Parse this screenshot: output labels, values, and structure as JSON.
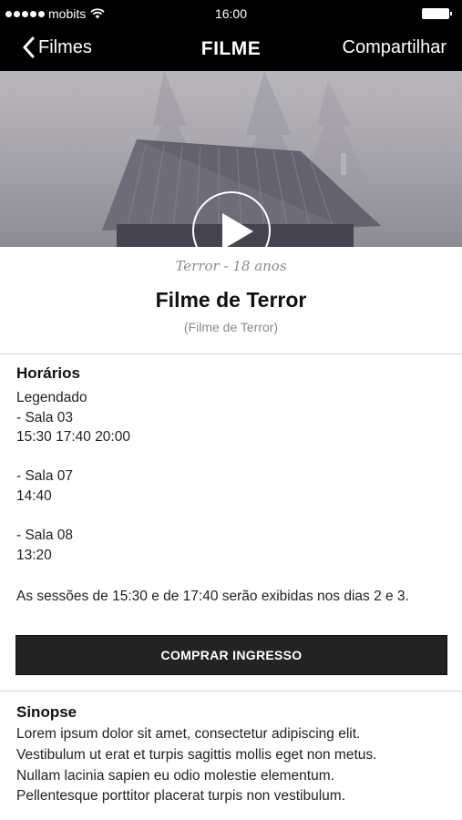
{
  "status_bar": {
    "carrier": "mobits",
    "time": "16:00",
    "signal_icon": "signal-dots-icon",
    "wifi_icon": "wifi-icon",
    "battery_icon": "battery-icon"
  },
  "nav": {
    "back_label": "Filmes",
    "back_icon": "chevron-left-icon",
    "title": "FILME",
    "share_label": "Compartilhar"
  },
  "hero": {
    "play_icon": "play-icon"
  },
  "movie": {
    "genre_rating": "Terror - 18 anos",
    "title": "Filme de Terror",
    "original_title": "(Filme de Terror)"
  },
  "schedule": {
    "heading": "Horários",
    "lines": [
      "Legendado",
      "- Sala 03",
      "15:30 17:40 20:00",
      "- Sala 07",
      "14:40",
      "- Sala 08",
      "13:20"
    ],
    "note": "As sessões de 15:30 e de 17:40 serão exibidas nos dias 2 e 3."
  },
  "buy_button": {
    "label": "COMPRAR INGRESSO"
  },
  "synopsis": {
    "heading": "Sinopse",
    "lines": [
      "Lorem ipsum dolor sit amet, consectetur adipiscing elit.",
      "Vestibulum ut erat et turpis sagittis mollis eget non metus.",
      "Nullam lacinia sapien eu odio molestie elementum.",
      "Pellentesque porttitor placerat turpis non vestibulum."
    ]
  },
  "colors": {
    "bar_background": "#000000",
    "button_background": "#232323",
    "muted_text": "#8c8c8c",
    "divider": "#d4d4d4"
  }
}
